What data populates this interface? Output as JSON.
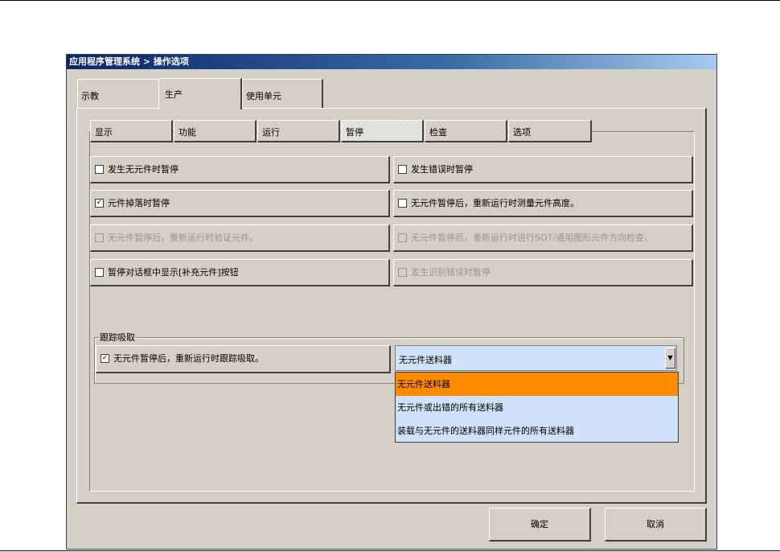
{
  "window": {
    "title": "应用程序管理系统 > 操作选项"
  },
  "main_tabs": [
    {
      "label": "示教",
      "active": false
    },
    {
      "label": "生产",
      "active": true
    },
    {
      "label": "使用单元",
      "active": false
    }
  ],
  "sub_tabs": [
    {
      "label": "显示",
      "active": false
    },
    {
      "label": "功能",
      "active": false
    },
    {
      "label": "运行",
      "active": false
    },
    {
      "label": "暂停",
      "active": true
    },
    {
      "label": "检查",
      "active": false
    },
    {
      "label": "选项",
      "active": false
    }
  ],
  "options": {
    "pause_no_component": {
      "label": "发生无元件时暂停",
      "checked": false,
      "enabled": true
    },
    "pause_on_error": {
      "label": "发生错误时暂停",
      "checked": false,
      "enabled": true
    },
    "pause_component_drop": {
      "label": "元件掉落时暂停",
      "checked": true,
      "enabled": true
    },
    "measure_height_after_restart": {
      "label": "无元件暂停后，重新运行时测量元件高度。",
      "checked": false,
      "enabled": true
    },
    "verify_component_after_restart": {
      "label": "无元件暂停后，重新运行时验证元件。",
      "checked": false,
      "enabled": false
    },
    "sot_direction_check_after_restart": {
      "label": "无元件暂停后，重新运行时进行SOT/通用图形元件方向检查。",
      "checked": false,
      "enabled": false
    },
    "show_replenish_button": {
      "label": "暂停对话框中显示[补充元件]按钮",
      "checked": false,
      "enabled": true
    },
    "pause_recognition_error": {
      "label": "发生识别错误时暂停",
      "checked": false,
      "enabled": false
    }
  },
  "tracking_group": {
    "title": "跟踪吸取",
    "checkbox": {
      "label": "无元件暂停后，重新运行时跟踪吸取。",
      "checked": true
    },
    "dropdown": {
      "selected": "无元件送料器",
      "options": [
        "无元件送料器",
        "无元件或出错的所有送料器",
        "装载与无元件的送料器同样元件的所有送料器"
      ],
      "highlighted_index": 0
    }
  },
  "buttons": {
    "ok": "确定",
    "cancel": "取消"
  },
  "icons": {
    "check_mark": "✓",
    "dropdown_arrow": "▼"
  },
  "colors": {
    "title_bar_start": "#0a246a",
    "title_bar_end": "#a6caf0",
    "dialog_bg": "#d4d0c8",
    "dropdown_bg": "#cfe2f9",
    "highlight": "#ff8c00"
  }
}
